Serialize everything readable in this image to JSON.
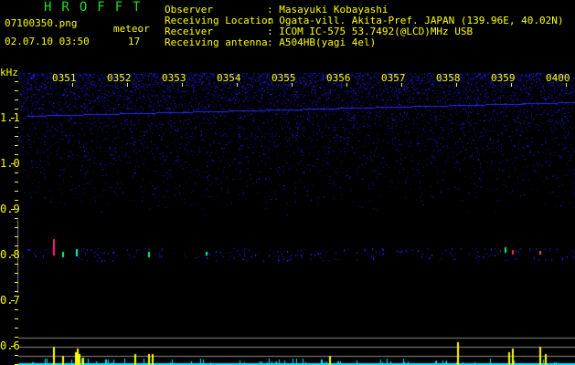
{
  "app_title": "HROFFT",
  "file_name": "07100350.png",
  "datetime": "02.07.10 03:50",
  "meteor_label": "meteor",
  "meteor_count": "17",
  "info": [
    {
      "label": "Observer",
      "value": "Masayuki Kobayashi"
    },
    {
      "label": "Receiving Location",
      "value": "Ogata-vill. Akita-Pref. JAPAN (139.96E, 40.02N)"
    },
    {
      "label": "Receiver",
      "value": "ICOM IC-575 53.7492(@LCD)MHz USB"
    },
    {
      "label": "Receiving antenna",
      "value": "A504HB(yagi 4el)"
    }
  ],
  "y_axis": {
    "unit": "kHz",
    "labels": [
      "1.1",
      "1.0",
      "0.9",
      "0.8",
      "0.7",
      "0.6"
    ]
  },
  "time_labels": [
    "0351",
    "0352",
    "0353",
    "0354",
    "0355",
    "0356",
    "0357",
    "0358",
    "0359",
    "0400"
  ],
  "colors": {
    "text": "#ffff00",
    "title": "#22dd22",
    "noise": "#1a1aff",
    "counts": "#00e5ff",
    "events": "#ffff00"
  }
}
